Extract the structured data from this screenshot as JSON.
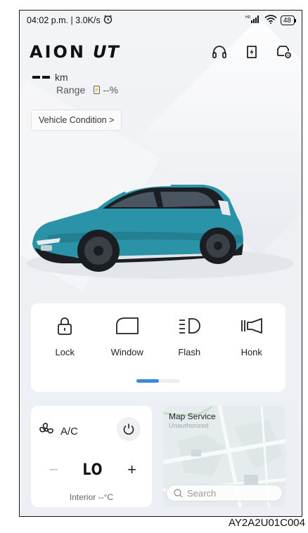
{
  "status_bar": {
    "time_speed": "04:02 p.m. | 3.0K/s",
    "battery_level": "48"
  },
  "header": {
    "brand": "AION",
    "model": "UT",
    "icons": [
      "headset-icon",
      "charging-icon",
      "car-settings-icon"
    ]
  },
  "range": {
    "value": "--",
    "unit": "km",
    "label": "Range",
    "battery_percent": "--%"
  },
  "vehicle_condition_button": "Vehicle Condition >",
  "controls": [
    {
      "label": "Lock",
      "icon": "lock-icon"
    },
    {
      "label": "Window",
      "icon": "window-icon"
    },
    {
      "label": "Flash",
      "icon": "flash-icon"
    },
    {
      "label": "Honk",
      "icon": "honk-icon"
    }
  ],
  "pager": {
    "pages": 2,
    "active": 1
  },
  "ac": {
    "label": "A/C",
    "minus": "−",
    "temp": "LO",
    "plus": "+",
    "interior": "Interior --°C"
  },
  "map": {
    "title": "Map Service",
    "subtitle": "Unauthorized",
    "search_placeholder": "Search"
  },
  "reference_code": "AY2A2U01C004",
  "colors": {
    "accent": "#3a8bd6",
    "car_body": "#2a93a8"
  }
}
